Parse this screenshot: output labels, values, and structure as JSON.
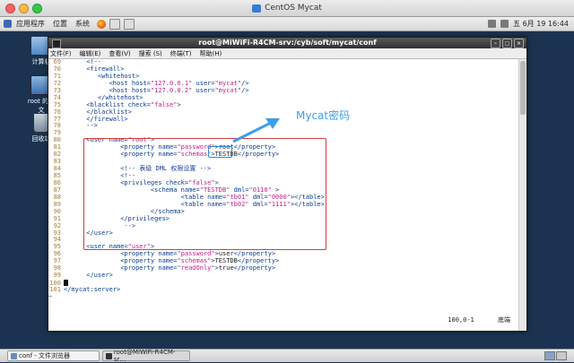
{
  "vm_window": {
    "title": "CentOS Mycat"
  },
  "gnome_panel": {
    "menus": [
      "应用程序",
      "位置",
      "系统"
    ],
    "clock": "五 6月 19 16:44"
  },
  "desktop_icons": [
    {
      "label": "计算机"
    },
    {
      "label": "root 的主文"
    },
    {
      "label": "回收站"
    }
  ],
  "terminal": {
    "title": "root@MiWiFi-R4CM-srv:/cyb/soft/mycat/conf",
    "menu": [
      "文件(F)",
      "编辑(E)",
      "查看(V)",
      "搜索 (S)",
      "终端(T)",
      "帮助(H)"
    ],
    "lines": [
      {
        "n": "69",
        "parts": [
          {
            "c": "tag",
            "t": "      <!--"
          }
        ]
      },
      {
        "n": "70",
        "parts": [
          {
            "c": "tag",
            "t": "      <firewall>"
          }
        ]
      },
      {
        "n": "71",
        "parts": [
          {
            "c": "tag",
            "t": "         <whitehost>"
          }
        ]
      },
      {
        "n": "72",
        "parts": [
          {
            "c": "tag",
            "t": "            <host "
          },
          {
            "c": "attr",
            "t": "host="
          },
          {
            "c": "str",
            "t": "\"127.0.0.1\""
          },
          {
            "c": "attr",
            "t": " user="
          },
          {
            "c": "str",
            "t": "\"mycat\""
          },
          {
            "c": "tag",
            "t": "/>"
          }
        ]
      },
      {
        "n": "73",
        "parts": [
          {
            "c": "tag",
            "t": "            <host "
          },
          {
            "c": "attr",
            "t": "host="
          },
          {
            "c": "str",
            "t": "\"127.0.0.2\""
          },
          {
            "c": "attr",
            "t": " user="
          },
          {
            "c": "str",
            "t": "\"mycat\""
          },
          {
            "c": "tag",
            "t": "/>"
          }
        ]
      },
      {
        "n": "74",
        "parts": [
          {
            "c": "tag",
            "t": "         </whitehost>"
          }
        ]
      },
      {
        "n": "75",
        "parts": [
          {
            "c": "tag",
            "t": "      <blacklist "
          },
          {
            "c": "attr",
            "t": "check="
          },
          {
            "c": "str",
            "t": "\"false\""
          },
          {
            "c": "tag",
            "t": ">"
          }
        ]
      },
      {
        "n": "76",
        "parts": [
          {
            "c": "tag",
            "t": "      </blacklist>"
          }
        ]
      },
      {
        "n": "77",
        "parts": [
          {
            "c": "tag",
            "t": "      </firewall>"
          }
        ]
      },
      {
        "n": "78",
        "parts": [
          {
            "c": "tag",
            "t": "      -->"
          }
        ]
      },
      {
        "n": "79",
        "parts": []
      },
      {
        "n": "80",
        "parts": [
          {
            "c": "tag",
            "t": "      <user "
          },
          {
            "c": "attr",
            "t": "name="
          },
          {
            "c": "str",
            "t": "\"root\""
          },
          {
            "c": "tag",
            "t": ">"
          }
        ]
      },
      {
        "n": "81",
        "parts": [
          {
            "c": "tag",
            "t": "               <property "
          },
          {
            "c": "attr",
            "t": "name="
          },
          {
            "c": "str",
            "t": "\"password\""
          },
          {
            "c": "tag",
            "t": ">"
          },
          {
            "c": "txt",
            "t": "root"
          },
          {
            "c": "tag",
            "t": "</property>"
          }
        ]
      },
      {
        "n": "82",
        "parts": [
          {
            "c": "tag",
            "t": "               <property "
          },
          {
            "c": "attr",
            "t": "name="
          },
          {
            "c": "str",
            "t": "\"schemas\""
          },
          {
            "c": "tag",
            "t": ">"
          },
          {
            "c": "txt",
            "t": "TESTDB"
          },
          {
            "c": "tag",
            "t": "</property>"
          }
        ]
      },
      {
        "n": "83",
        "parts": []
      },
      {
        "n": "84",
        "parts": [
          {
            "c": "cmt",
            "t": "               <!-- 表级 DML 权限设置 -->"
          }
        ]
      },
      {
        "n": "85",
        "parts": [
          {
            "c": "cmt",
            "t": "               <!--"
          }
        ]
      },
      {
        "n": "86",
        "parts": [
          {
            "c": "tag",
            "t": "               <privileges "
          },
          {
            "c": "attr",
            "t": "check="
          },
          {
            "c": "str",
            "t": "\"false\""
          },
          {
            "c": "tag",
            "t": ">"
          }
        ]
      },
      {
        "n": "87",
        "parts": [
          {
            "c": "tag",
            "t": "                       <schema "
          },
          {
            "c": "attr",
            "t": "name="
          },
          {
            "c": "str",
            "t": "\"TESTDB\""
          },
          {
            "c": "attr",
            "t": " dml="
          },
          {
            "c": "str",
            "t": "\"0110\""
          },
          {
            "c": "tag",
            "t": " >"
          }
        ]
      },
      {
        "n": "88",
        "parts": [
          {
            "c": "tag",
            "t": "                               <table "
          },
          {
            "c": "attr",
            "t": "name="
          },
          {
            "c": "str",
            "t": "\"tb01\""
          },
          {
            "c": "attr",
            "t": " dml="
          },
          {
            "c": "str",
            "t": "\"0000\""
          },
          {
            "c": "tag",
            "t": "></table>"
          }
        ]
      },
      {
        "n": "89",
        "parts": [
          {
            "c": "tag",
            "t": "                               <table "
          },
          {
            "c": "attr",
            "t": "name="
          },
          {
            "c": "str",
            "t": "\"tb02\""
          },
          {
            "c": "attr",
            "t": " dml="
          },
          {
            "c": "str",
            "t": "\"1111\""
          },
          {
            "c": "tag",
            "t": "></table>"
          }
        ]
      },
      {
        "n": "90",
        "parts": [
          {
            "c": "tag",
            "t": "                       </schema>"
          }
        ]
      },
      {
        "n": "91",
        "parts": [
          {
            "c": "tag",
            "t": "               </privileges>"
          }
        ]
      },
      {
        "n": "92",
        "parts": [
          {
            "c": "cmt",
            "t": "                -->"
          }
        ]
      },
      {
        "n": "93",
        "parts": [
          {
            "c": "tag",
            "t": "      </user>"
          }
        ]
      },
      {
        "n": "94",
        "parts": []
      },
      {
        "n": "95",
        "parts": [
          {
            "c": "tag",
            "t": "      <user "
          },
          {
            "c": "attr",
            "t": "name="
          },
          {
            "c": "str",
            "t": "\"user\""
          },
          {
            "c": "tag",
            "t": ">"
          }
        ]
      },
      {
        "n": "96",
        "parts": [
          {
            "c": "tag",
            "t": "               <property "
          },
          {
            "c": "attr",
            "t": "name="
          },
          {
            "c": "str",
            "t": "\"password\""
          },
          {
            "c": "tag",
            "t": ">"
          },
          {
            "c": "txt",
            "t": "user"
          },
          {
            "c": "tag",
            "t": "</property>"
          }
        ]
      },
      {
        "n": "97",
        "parts": [
          {
            "c": "tag",
            "t": "               <property "
          },
          {
            "c": "attr",
            "t": "name="
          },
          {
            "c": "str",
            "t": "\"schemas\""
          },
          {
            "c": "tag",
            "t": ">"
          },
          {
            "c": "txt",
            "t": "TESTDB"
          },
          {
            "c": "tag",
            "t": "</property>"
          }
        ]
      },
      {
        "n": "98",
        "parts": [
          {
            "c": "tag",
            "t": "               <property "
          },
          {
            "c": "attr",
            "t": "name="
          },
          {
            "c": "str",
            "t": "\"readOnly\""
          },
          {
            "c": "tag",
            "t": ">"
          },
          {
            "c": "txt",
            "t": "true"
          },
          {
            "c": "tag",
            "t": "</property>"
          }
        ]
      },
      {
        "n": "99",
        "parts": [
          {
            "c": "tag",
            "t": "      </user>"
          }
        ]
      },
      {
        "n": "100",
        "parts": [],
        "cursor": true
      },
      {
        "n": "101",
        "parts": [
          {
            "c": "tag",
            "t": "</mycat:server>"
          }
        ]
      }
    ],
    "tilde_lines": 1,
    "status_position": "100,0-1",
    "status_scroll": "底端"
  },
  "annotation": {
    "label": "Mycat密码",
    "red_box_color": "#d43c3c",
    "blue_box_color": "#2d8fd8"
  },
  "taskbar": {
    "tasks": [
      "conf - 文件浏览器",
      "root@MiWiFi-R4CM-sr…"
    ]
  }
}
